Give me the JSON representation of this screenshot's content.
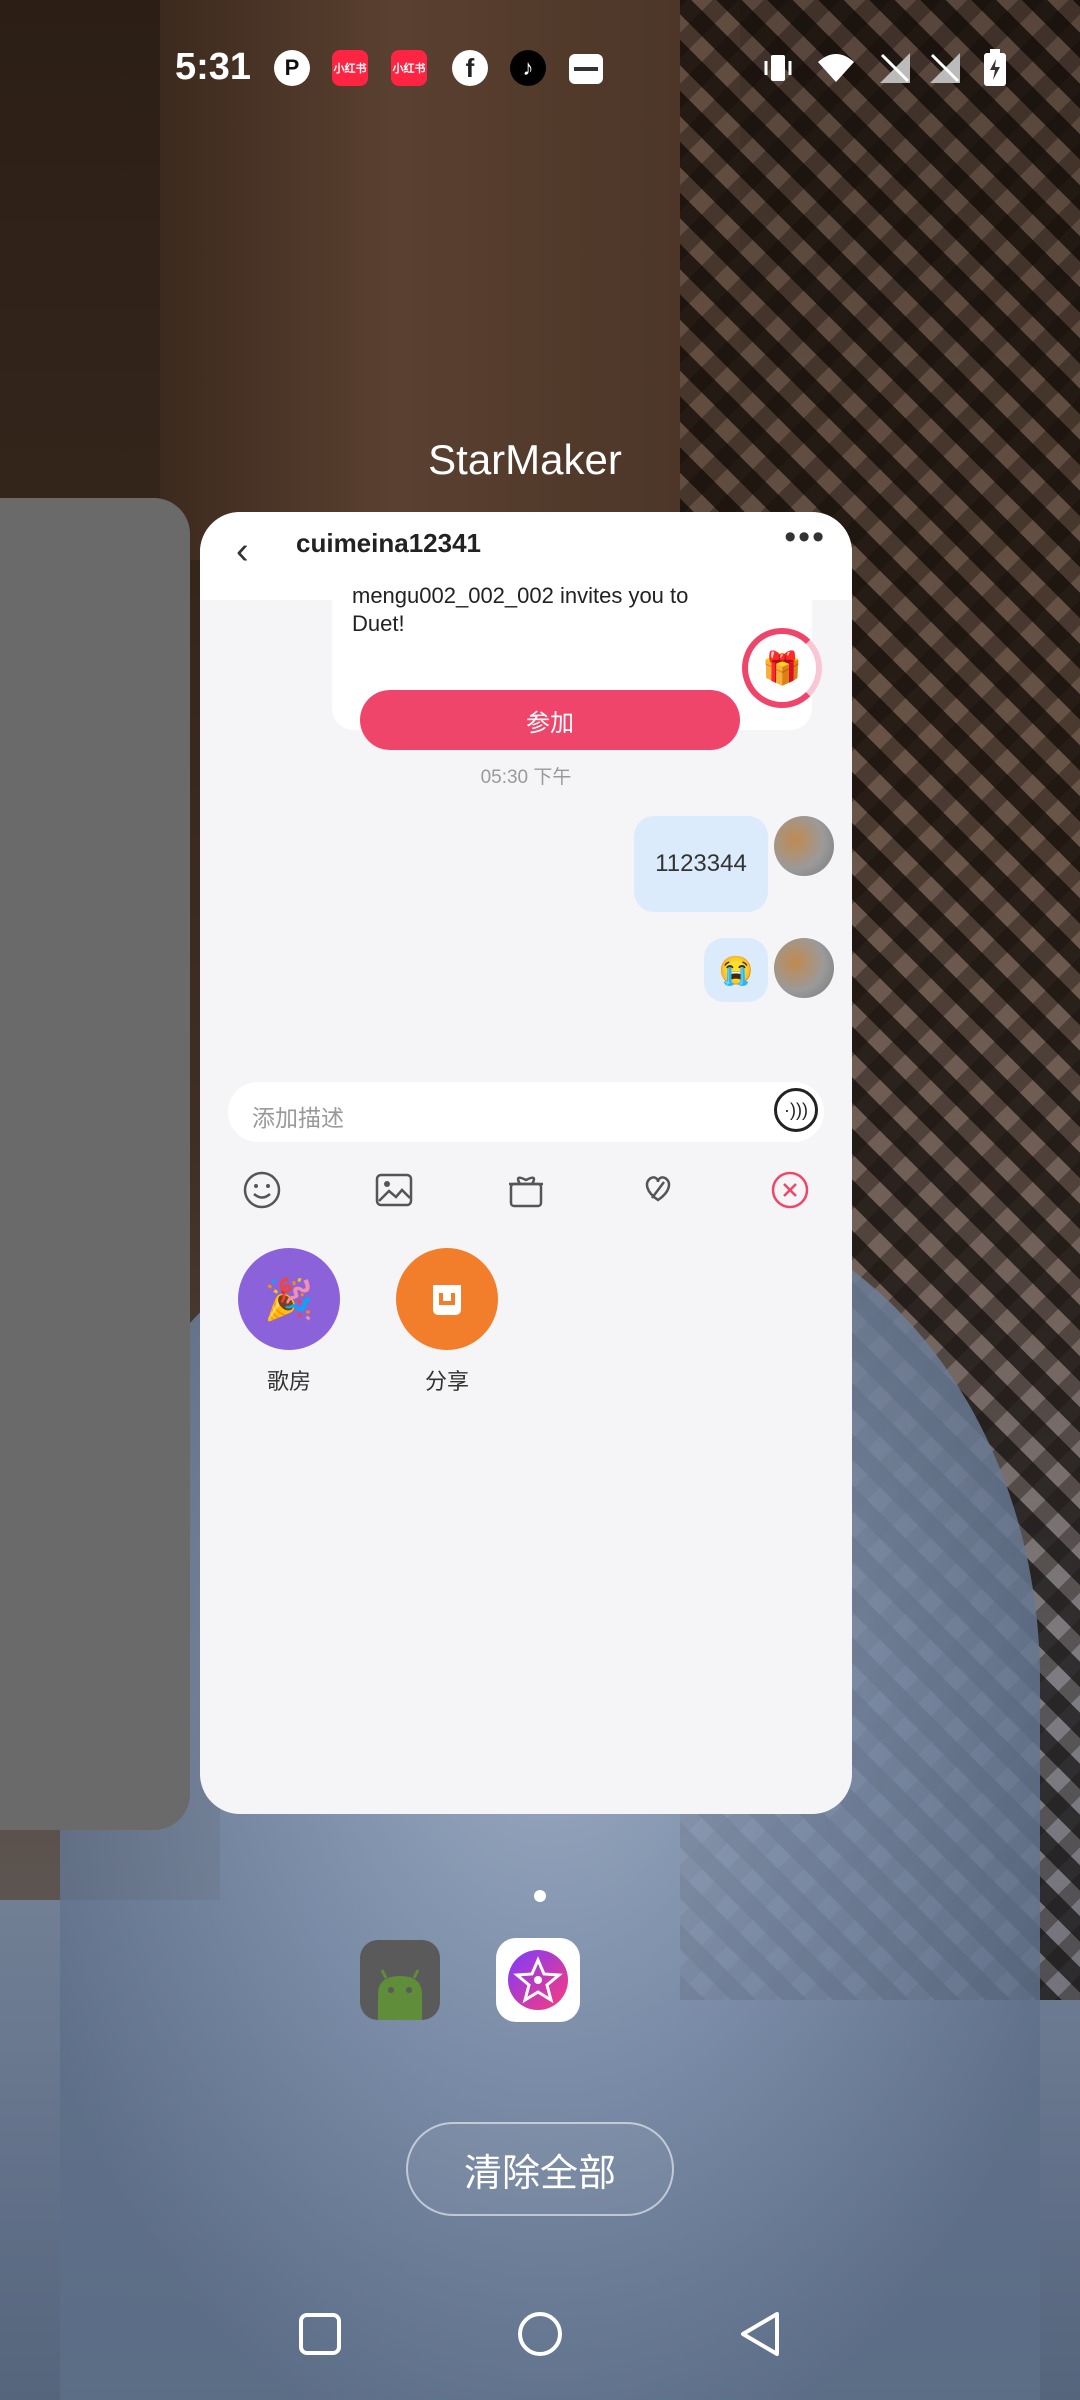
{
  "status_bar": {
    "time": "5:31",
    "notif_icons": [
      "p-icon",
      "xiaohongshu-icon",
      "xiaohongshu-icon",
      "facebook-icon",
      "tiktok-icon",
      "wallet-icon"
    ],
    "xhs_label": "小红书"
  },
  "recents": {
    "app_title": "StarMaker",
    "clear_all": "清除全部"
  },
  "chat": {
    "peer_name": "cuimeina12341",
    "invite_text_line1": "mengu002_002_002 invites you to",
    "invite_text_line2": "Duet!",
    "join_label": "参加",
    "timestamp": "05:30 下午",
    "messages": [
      {
        "text": "1123344",
        "from": "me"
      },
      {
        "text": "😭",
        "from": "me"
      }
    ],
    "input_placeholder": "添加描述",
    "quick_actions": [
      {
        "label": "歌房",
        "color": "#8b62d9"
      },
      {
        "label": "分享",
        "color": "#f27d2a"
      }
    ]
  },
  "colors": {
    "accent": "#f0456a",
    "bubble": "#dcebfc",
    "close": "#f0456a"
  }
}
